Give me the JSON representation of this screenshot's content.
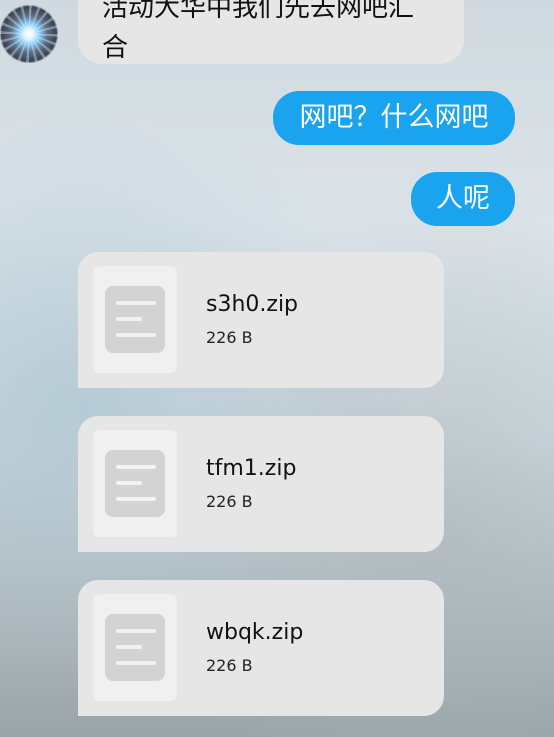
{
  "chat": {
    "incoming_text": "活动大华中我们先去网吧汇\n合",
    "outgoing": [
      {
        "text": "网吧？什么网吧"
      },
      {
        "text": "人呢"
      }
    ],
    "files": [
      {
        "name": "s3h0.zip",
        "size": "226 B"
      },
      {
        "name": "tfm1.zip",
        "size": "226 B"
      },
      {
        "name": "wbqk.zip",
        "size": "226 B"
      }
    ]
  },
  "colors": {
    "outgoing_bubble": "#1aa3ef",
    "incoming_bubble": "#e6e6e6"
  },
  "icons": {
    "avatar": "contact-avatar",
    "file": "document-file-icon"
  }
}
